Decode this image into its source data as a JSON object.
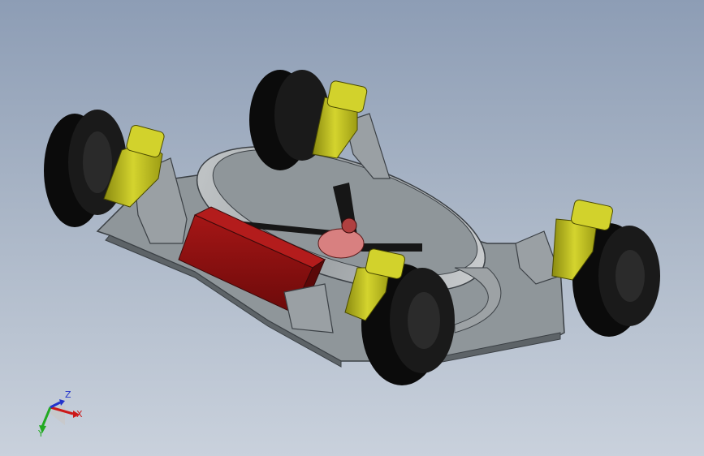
{
  "window": {
    "viewport_background_top": "#8d9db5",
    "viewport_background_bottom": "#c9d1dc"
  },
  "model": {
    "colors": {
      "chassis": "#8f969a",
      "chassis_edge": "#3b4045",
      "duct": "#a9aeb1",
      "battery": "#8c1010",
      "motor": "#b8b820",
      "tire": "#0b0b0b",
      "propeller": "#161616",
      "prop_motor": "#d88080"
    },
    "parts": {
      "wheel_count": 4,
      "motor_count": 4
    }
  },
  "triad": {
    "x_label": "X",
    "y_label": "Y",
    "z_label": "Z",
    "x_color": "#cc1818",
    "y_color": "#22aa22",
    "z_color": "#2233cc"
  }
}
